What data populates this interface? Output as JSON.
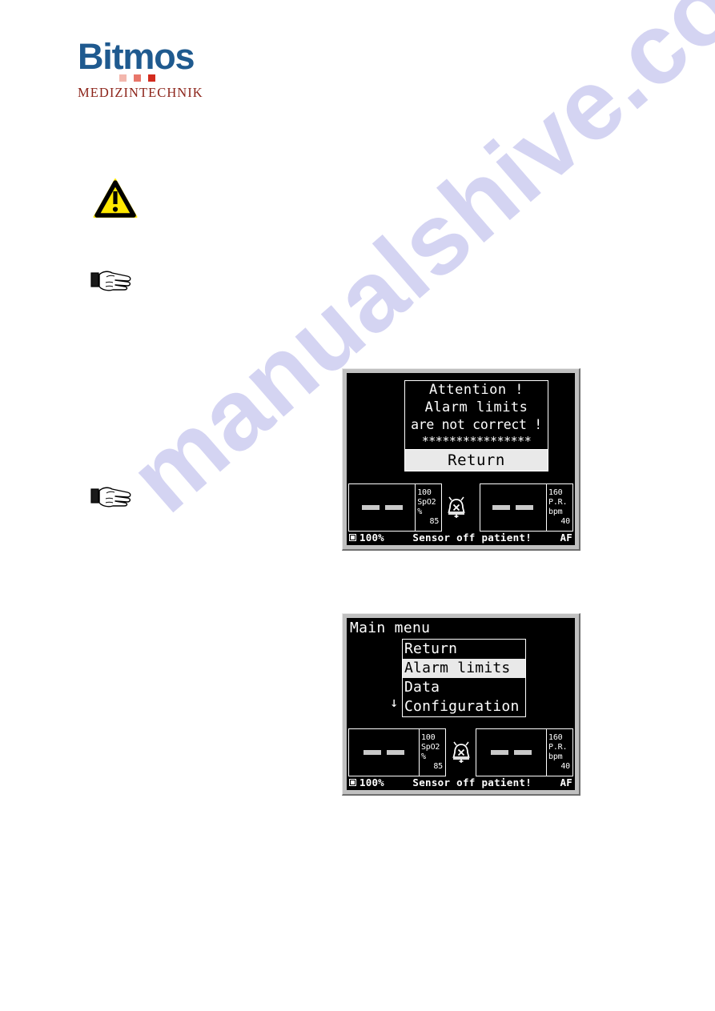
{
  "logo": {
    "wordmark": "Bitmos",
    "subtitle": "MEDIZINTECHNIK",
    "color_primary": "#1f5a8f",
    "color_secondary": "#8c2319",
    "square_colors": [
      "#f3b7ad",
      "#e8766a",
      "#d32b1e"
    ]
  },
  "watermark": {
    "text": "manualshive.com",
    "color": "#d4d4f2"
  },
  "icons": {
    "warning": "warning-triangle-icon",
    "hand_1": "pointing-hand-icon",
    "hand_2": "pointing-hand-icon"
  },
  "alert_screen": {
    "dialog": {
      "line1": "Attention !",
      "line2": "Alarm limits",
      "line3": "are not correct !",
      "stars": "****************",
      "button_label": "Return"
    },
    "spo2": {
      "value": "- -",
      "upper_limit": "100",
      "label": "SpO2",
      "unit": "%",
      "lower_limit": "85"
    },
    "bell_icon": "alarm-silenced-bell-icon",
    "pulse_rate": {
      "value": "- -",
      "upper_limit": "160",
      "label": "P.R.",
      "unit": "bpm",
      "lower_limit": "40"
    },
    "status": {
      "battery_icon": "battery-icon",
      "battery": "100%",
      "message": "Sensor off patient!",
      "right": "AF"
    }
  },
  "menu_screen": {
    "title": "Main menu",
    "items": [
      {
        "label": "Return",
        "selected": false
      },
      {
        "label": "Alarm limits",
        "selected": true
      },
      {
        "label": "Data",
        "selected": false
      },
      {
        "label": "Configuration",
        "selected": false
      }
    ],
    "scroll_indicator": "↓",
    "spo2": {
      "value": "- -",
      "upper_limit": "100",
      "label": "SpO2",
      "unit": "%",
      "lower_limit": "85"
    },
    "bell_icon": "alarm-silenced-bell-icon",
    "pulse_rate": {
      "value": "- -",
      "upper_limit": "160",
      "label": "P.R.",
      "unit": "bpm",
      "lower_limit": "40"
    },
    "status": {
      "battery_icon": "battery-icon",
      "battery": "100%",
      "message": "Sensor off patient!",
      "right": "AF"
    }
  }
}
